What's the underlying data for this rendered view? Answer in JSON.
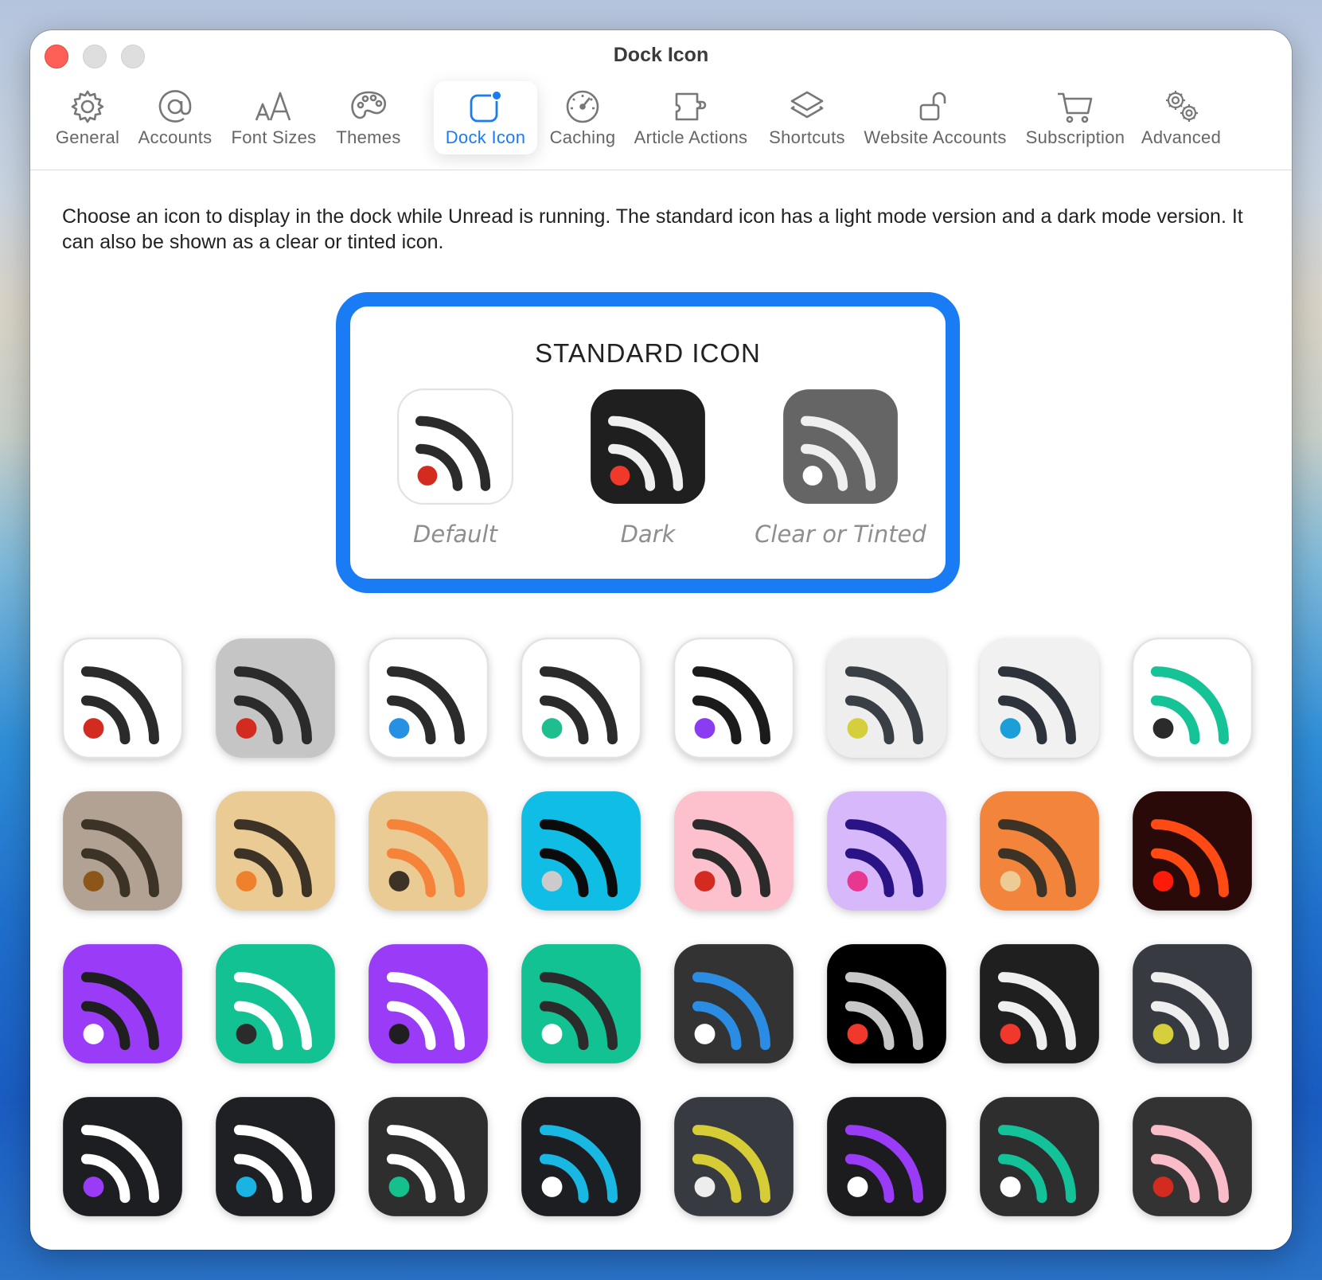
{
  "window": {
    "title": "Dock Icon"
  },
  "toolbar": {
    "tabs": [
      {
        "label": "General",
        "icon": "gear-icon"
      },
      {
        "label": "Accounts",
        "icon": "at-sign-icon"
      },
      {
        "label": "Font Sizes",
        "icon": "font-size-icon"
      },
      {
        "label": "Themes",
        "icon": "palette-icon"
      },
      {
        "label": "Dock Icon",
        "icon": "dock-icon-icon",
        "active": true
      },
      {
        "label": "Caching",
        "icon": "speedometer-icon"
      },
      {
        "label": "Article Actions",
        "icon": "puzzle-icon"
      },
      {
        "label": "Shortcuts",
        "icon": "layers-icon"
      },
      {
        "label": "Website Accounts",
        "icon": "unlock-icon"
      },
      {
        "label": "Subscription",
        "icon": "cart-icon"
      },
      {
        "label": "Advanced",
        "icon": "gears-icon"
      }
    ]
  },
  "description": "Choose an icon to display in the dock while Unread is running. The standard icon has a light mode version and a dark mode version. It can also be shown as a clear or tinted icon.",
  "standard": {
    "title": "STANDARD ICON",
    "selected": true,
    "items": [
      {
        "caption": "Default",
        "bg": "#ffffff",
        "arcs": "#2b2b2b",
        "dot": "#d42b20",
        "border": true
      },
      {
        "caption": "Dark",
        "bg": "#1f1f1f",
        "arcs": "#efefef",
        "dot": "#f0392b"
      },
      {
        "caption": "Clear or Tinted",
        "bg": "#656565",
        "arcs": "#efefef",
        "dot": "#ffffff"
      }
    ]
  },
  "accent_color": "#1a7cf5",
  "icons": [
    {
      "bg": "#ffffff",
      "arcs": "#2b2b2b",
      "dot": "#d42b20",
      "border": true
    },
    {
      "bg": "#c5c5c5",
      "arcs": "#2b2b2b",
      "dot": "#d42b20"
    },
    {
      "bg": "#ffffff",
      "arcs": "#2b2b2b",
      "dot": "#2690e2",
      "border": true
    },
    {
      "bg": "#ffffff",
      "arcs": "#2b2b2b",
      "dot": "#1dbf90",
      "border": true
    },
    {
      "bg": "#ffffff",
      "arcs": "#1b1b1b",
      "dot": "#8a3cf2",
      "border": true
    },
    {
      "bg": "#eeeeee",
      "arcs": "#3a3f46",
      "dot": "#d4cf3a"
    },
    {
      "bg": "#f1f1f1",
      "arcs": "#2e323a",
      "dot": "#1a9fd9"
    },
    {
      "bg": "#ffffff",
      "arcs": "#15c396",
      "dot": "#2b2b2b",
      "border": true
    },
    {
      "bg": "#b1a293",
      "arcs": "#3c3226",
      "dot": "#8c5618"
    },
    {
      "bg": "#eacb94",
      "arcs": "#3c3226",
      "dot": "#f0812c"
    },
    {
      "bg": "#eacb94",
      "arcs": "#f5843a",
      "dot": "#3c3226"
    },
    {
      "bg": "#10bde4",
      "arcs": "#0b0b0b",
      "dot": "#cbcbcb"
    },
    {
      "bg": "#fdc0cd",
      "arcs": "#2b2b2b",
      "dot": "#d42b20"
    },
    {
      "bg": "#d7b8fb",
      "arcs": "#2a1385",
      "dot": "#e8378e"
    },
    {
      "bg": "#f2843b",
      "arcs": "#3c3226",
      "dot": "#eccb94"
    },
    {
      "bg": "#2a0909",
      "arcs": "#ff4a14",
      "dot": "#ff1a0a"
    },
    {
      "bg": "#9a3cf7",
      "arcs": "#1f1f1f",
      "dot": "#ffffff"
    },
    {
      "bg": "#12c293",
      "arcs": "#ffffff",
      "dot": "#2b2b2b"
    },
    {
      "bg": "#9a3cf7",
      "arcs": "#ffffff",
      "dot": "#1f1f1f"
    },
    {
      "bg": "#12c293",
      "arcs": "#2b2b2b",
      "dot": "#ffffff"
    },
    {
      "bg": "#333333",
      "arcs": "#2a8de3",
      "dot": "#ffffff"
    },
    {
      "bg": "#000000",
      "arcs": "#c8c8c8",
      "dot": "#f0392b"
    },
    {
      "bg": "#1f1f1f",
      "arcs": "#efefef",
      "dot": "#f0392b"
    },
    {
      "bg": "#373b41",
      "arcs": "#efefef",
      "dot": "#d4cf3a"
    },
    {
      "bg": "#1c1e22",
      "arcs": "#ffffff",
      "dot": "#9a3cf7"
    },
    {
      "bg": "#1e2023",
      "arcs": "#ffffff",
      "dot": "#19b4e3"
    },
    {
      "bg": "#2e2e2e",
      "arcs": "#ffffff",
      "dot": "#14c08e"
    },
    {
      "bg": "#1c1e22",
      "arcs": "#19b8e3",
      "dot": "#ffffff"
    },
    {
      "bg": "#373b41",
      "arcs": "#d5cc36",
      "dot": "#ededed"
    },
    {
      "bg": "#1c1c1f",
      "arcs": "#9a3cf7",
      "dot": "#ffffff"
    },
    {
      "bg": "#2e2e2e",
      "arcs": "#14c29a",
      "dot": "#ffffff"
    },
    {
      "bg": "#333333",
      "arcs": "#fbbcca",
      "dot": "#d42b20"
    }
  ]
}
